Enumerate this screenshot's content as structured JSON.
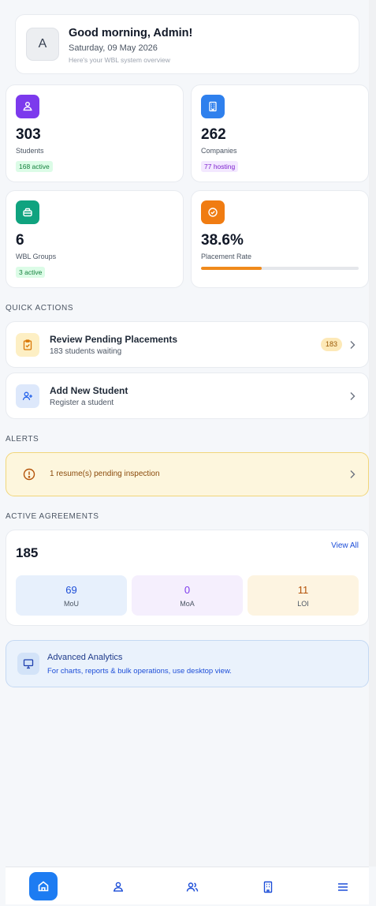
{
  "greeting": {
    "avatar_initial": "A",
    "title": "Good morning, Admin!",
    "date": "Saturday, 09 May 2026",
    "subtitle": "Here's your WBL system overview"
  },
  "stats": [
    {
      "icon": "students-icon",
      "value": "303",
      "label": "Students",
      "badge": "168 active",
      "color": "#7c3aed"
    },
    {
      "icon": "building-icon",
      "value": "262",
      "label": "Companies",
      "badge": "77 hosting",
      "color": "#2563eb"
    },
    {
      "icon": "groups-icon",
      "value": "6",
      "label": "WBL Groups",
      "badge": "3 active",
      "color": "#10a37f"
    },
    {
      "icon": "check-circle-icon",
      "value": "38.6%",
      "label": "Placement Rate",
      "progress": 0.386,
      "color": "#f07c12"
    }
  ],
  "sections": {
    "quick_actions": "QUICK ACTIONS",
    "alerts": "ALERTS",
    "active_agreements": "ACTIVE AGREEMENTS"
  },
  "actions": [
    {
      "title": "Review Pending Placements",
      "subtitle": "183 students waiting",
      "count": "183",
      "icon": "clipboard-check-icon"
    },
    {
      "title": "Add New Student",
      "subtitle": "Register a student",
      "icon": "user-plus-icon"
    }
  ],
  "alert": {
    "text": "1 resume(s) pending inspection",
    "icon": "warning-circle-icon"
  },
  "agreements": {
    "total": "185",
    "view_all": "View All",
    "tiles": [
      {
        "value": "69",
        "label": "MoU",
        "color": "#1d4ed8"
      },
      {
        "value": "0",
        "label": "MoA",
        "color": "#7c3aed"
      },
      {
        "value": "11",
        "label": "LOI",
        "color": "#b45309"
      }
    ]
  },
  "analytics": {
    "title": "Advanced Analytics",
    "subtitle": "For charts, reports & bulk operations, use desktop view."
  },
  "nav": [
    "home-icon",
    "students-icon",
    "users-icon",
    "building-icon",
    "menu-icon"
  ]
}
